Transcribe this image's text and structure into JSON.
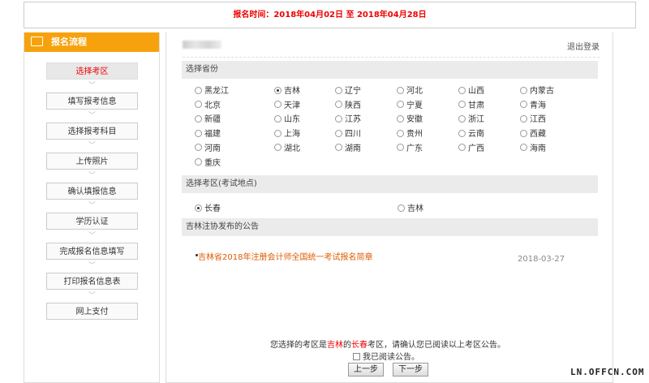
{
  "banner": {
    "label": "报名时间：",
    "period": "2018年04月02日 至 2018年04月28日"
  },
  "sidebar": {
    "title": "报名流程",
    "steps": [
      "选择考区",
      "填写报考信息",
      "选择报考科目",
      "上传照片",
      "确认填报信息",
      "学历认证",
      "完成报名信息填写",
      "打印报名信息表",
      "网上支付"
    ]
  },
  "main": {
    "logout": "退出登录",
    "province_title": "选择省份",
    "provinces": [
      "黑龙江",
      "吉林",
      "辽宁",
      "河北",
      "山西",
      "内蒙古",
      "北京",
      "天津",
      "陕西",
      "宁夏",
      "甘肃",
      "青海",
      "新疆",
      "山东",
      "江苏",
      "安徽",
      "浙江",
      "江西",
      "福建",
      "上海",
      "四川",
      "贵州",
      "云南",
      "西藏",
      "河南",
      "湖北",
      "湖南",
      "广东",
      "广西",
      "海南",
      "重庆"
    ],
    "selected_province": "吉林",
    "area_title": "选择考区(考试地点)",
    "areas": [
      "长春",
      "吉林"
    ],
    "selected_area": "长春",
    "notice_title": "吉林注协发布的公告",
    "notice_text": "吉林省2018年注册会计师全国统一考试报名简章",
    "notice_date": "2018-03-27",
    "confirm_pre": "您选择的考区是",
    "confirm_prov": "吉林",
    "confirm_mid": "的",
    "confirm_area": "长春",
    "confirm_post": "考区，请确认您已阅读以上考区公告。",
    "agree_label": "我已阅读公告。",
    "prev_label": "上一步",
    "next_label": "下一步"
  },
  "watermark": "LN.OFFCN.COM"
}
